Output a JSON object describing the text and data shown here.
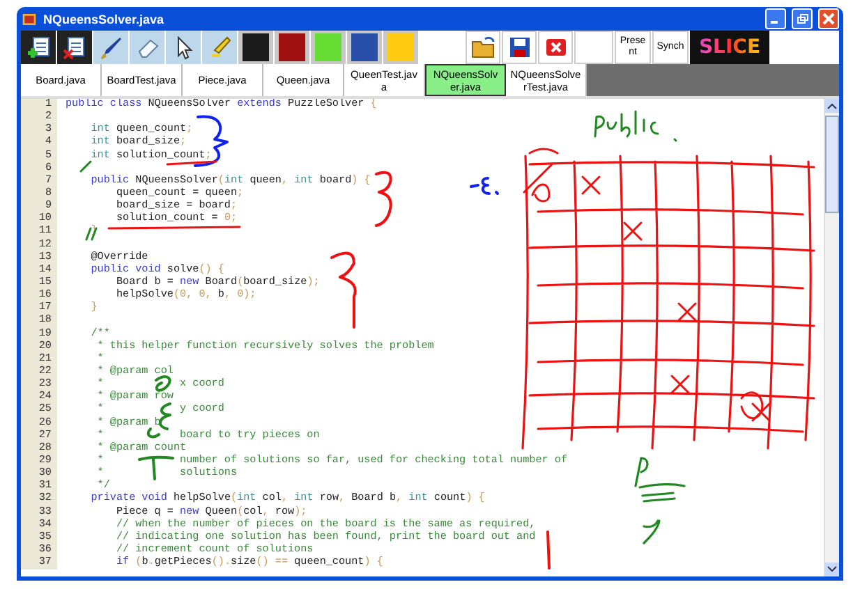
{
  "window": {
    "title": "NQueensSolver.java"
  },
  "toolbar": {
    "colors": [
      {
        "color": "#1a1a1a"
      },
      {
        "color": "#a01010"
      },
      {
        "color": "#66dd33"
      },
      {
        "color": "#2850a8"
      },
      {
        "color": "#ffcc11"
      }
    ],
    "text_buttons": [
      "Present",
      "Synch"
    ],
    "logo": "SLICE"
  },
  "tabs": [
    {
      "label": "Board.java",
      "selected": false
    },
    {
      "label": "BoardTest.java",
      "selected": false
    },
    {
      "label": "Piece.java",
      "selected": false
    },
    {
      "label": "Queen.java",
      "selected": false
    },
    {
      "label": "QueenTest.java",
      "selected": false
    },
    {
      "label": "NQueensSolver.java",
      "selected": true
    },
    {
      "label": "NQueensSolverTest.java",
      "selected": false
    }
  ],
  "editor": {
    "lines": [
      {
        "num": "1",
        "segments": [
          {
            "t": "public class ",
            "kind": "keyword"
          },
          {
            "t": "NQueensSolver ",
            "kind": "plain"
          },
          {
            "t": "extends ",
            "kind": "keyword"
          },
          {
            "t": "PuzzleSolver ",
            "kind": "plain"
          },
          {
            "t": "{",
            "kind": "punct"
          }
        ]
      },
      {
        "num": "2"
      },
      {
        "num": "3",
        "segments": [
          {
            "t": "    int ",
            "kind": "type"
          },
          {
            "t": "queen_count",
            "kind": "plain"
          },
          {
            "t": ";",
            "kind": "punct"
          }
        ]
      },
      {
        "num": "4",
        "segments": [
          {
            "t": "    int ",
            "kind": "type"
          },
          {
            "t": "board_size",
            "kind": "plain"
          },
          {
            "t": ";",
            "kind": "punct"
          }
        ]
      },
      {
        "num": "5",
        "segments": [
          {
            "t": "    int ",
            "kind": "type"
          },
          {
            "t": "solution_count",
            "kind": "plain"
          },
          {
            "t": ";",
            "kind": "punct"
          }
        ]
      },
      {
        "num": "6"
      },
      {
        "num": "7",
        "segments": [
          {
            "t": "    public ",
            "kind": "keyword"
          },
          {
            "t": "NQueensSolver",
            "kind": "plain"
          },
          {
            "t": "(",
            "kind": "punct"
          },
          {
            "t": "int ",
            "kind": "type"
          },
          {
            "t": "queen",
            "kind": "plain"
          },
          {
            "t": ", ",
            "kind": "punct"
          },
          {
            "t": "int ",
            "kind": "type"
          },
          {
            "t": "board",
            "kind": "plain"
          },
          {
            "t": ") {",
            "kind": "punct"
          }
        ]
      },
      {
        "num": "8",
        "segments": [
          {
            "t": "        queen_count = queen",
            "kind": "plain"
          },
          {
            "t": ";",
            "kind": "punct"
          }
        ]
      },
      {
        "num": "9",
        "segments": [
          {
            "t": "        board_size = board",
            "kind": "plain"
          },
          {
            "t": ";",
            "kind": "punct"
          }
        ]
      },
      {
        "num": "10",
        "segments": [
          {
            "t": "        solution_count = ",
            "kind": "plain"
          },
          {
            "t": "0;",
            "kind": "punct"
          }
        ]
      },
      {
        "num": "11",
        "segments": [
          {
            "t": "    }",
            "kind": "punct"
          }
        ]
      },
      {
        "num": "12"
      },
      {
        "num": "13",
        "segments": [
          {
            "t": "    @Override",
            "kind": "plain"
          }
        ]
      },
      {
        "num": "14",
        "segments": [
          {
            "t": "    public void ",
            "kind": "keyword"
          },
          {
            "t": "solve",
            "kind": "plain"
          },
          {
            "t": "() {",
            "kind": "punct"
          }
        ]
      },
      {
        "num": "15",
        "segments": [
          {
            "t": "        Board b = ",
            "kind": "plain"
          },
          {
            "t": "new ",
            "kind": "keyword"
          },
          {
            "t": "Board",
            "kind": "plain"
          },
          {
            "t": "(",
            "kind": "punct"
          },
          {
            "t": "board_size",
            "kind": "plain"
          },
          {
            "t": ");",
            "kind": "punct"
          }
        ]
      },
      {
        "num": "16",
        "segments": [
          {
            "t": "        helpSolve",
            "kind": "plain"
          },
          {
            "t": "(0, 0, ",
            "kind": "punct"
          },
          {
            "t": "b",
            "kind": "plain"
          },
          {
            "t": ", 0);",
            "kind": "punct"
          }
        ]
      },
      {
        "num": "17",
        "segments": [
          {
            "t": "    }",
            "kind": "punct"
          }
        ]
      },
      {
        "num": "18"
      },
      {
        "num": "19",
        "segments": [
          {
            "t": "    /**",
            "kind": "comment"
          }
        ]
      },
      {
        "num": "20",
        "segments": [
          {
            "t": "     * this helper function recursively solves the problem",
            "kind": "comment"
          }
        ]
      },
      {
        "num": "21",
        "segments": [
          {
            "t": "     *",
            "kind": "comment"
          }
        ]
      },
      {
        "num": "22",
        "segments": [
          {
            "t": "     * @param col",
            "kind": "comment"
          }
        ]
      },
      {
        "num": "23",
        "segments": [
          {
            "t": "     *            x coord",
            "kind": "comment"
          }
        ]
      },
      {
        "num": "24",
        "segments": [
          {
            "t": "     * @param row",
            "kind": "comment"
          }
        ]
      },
      {
        "num": "25",
        "segments": [
          {
            "t": "     *            y coord",
            "kind": "comment"
          }
        ]
      },
      {
        "num": "26",
        "segments": [
          {
            "t": "     * @param b",
            "kind": "comment"
          }
        ]
      },
      {
        "num": "27",
        "segments": [
          {
            "t": "     *            board to try pieces on",
            "kind": "comment"
          }
        ]
      },
      {
        "num": "28",
        "segments": [
          {
            "t": "     * @param count",
            "kind": "comment"
          }
        ]
      },
      {
        "num": "29",
        "segments": [
          {
            "t": "     *            number of solutions so far, used for checking total number of",
            "kind": "comment"
          }
        ]
      },
      {
        "num": "30",
        "segments": [
          {
            "t": "     *            solutions",
            "kind": "comment"
          }
        ]
      },
      {
        "num": "31",
        "segments": [
          {
            "t": "     */",
            "kind": "comment"
          }
        ]
      },
      {
        "num": "32",
        "segments": [
          {
            "t": "    private void ",
            "kind": "keyword"
          },
          {
            "t": "helpSolve",
            "kind": "plain"
          },
          {
            "t": "(",
            "kind": "punct"
          },
          {
            "t": "int ",
            "kind": "type"
          },
          {
            "t": "col",
            "kind": "plain"
          },
          {
            "t": ", ",
            "kind": "punct"
          },
          {
            "t": "int ",
            "kind": "type"
          },
          {
            "t": "row",
            "kind": "plain"
          },
          {
            "t": ", ",
            "kind": "punct"
          },
          {
            "t": "Board b",
            "kind": "plain"
          },
          {
            "t": ", ",
            "kind": "punct"
          },
          {
            "t": "int ",
            "kind": "type"
          },
          {
            "t": "count",
            "kind": "plain"
          },
          {
            "t": ") {",
            "kind": "punct"
          }
        ]
      },
      {
        "num": "33",
        "segments": [
          {
            "t": "        Piece q = ",
            "kind": "plain"
          },
          {
            "t": "new ",
            "kind": "keyword"
          },
          {
            "t": "Queen",
            "kind": "plain"
          },
          {
            "t": "(",
            "kind": "punct"
          },
          {
            "t": "col",
            "kind": "plain"
          },
          {
            "t": ", ",
            "kind": "punct"
          },
          {
            "t": "row",
            "kind": "plain"
          },
          {
            "t": ");",
            "kind": "punct"
          }
        ]
      },
      {
        "num": "34",
        "segments": [
          {
            "t": "        // when the number of pieces on the board is the same as required,",
            "kind": "comment"
          }
        ]
      },
      {
        "num": "35",
        "segments": [
          {
            "t": "        // indicating one solution has been found, print the board out and",
            "kind": "comment"
          }
        ]
      },
      {
        "num": "36",
        "segments": [
          {
            "t": "        // increment count of solutions",
            "kind": "comment"
          }
        ]
      },
      {
        "num": "37",
        "segments": [
          {
            "t": "        if ",
            "kind": "keyword"
          },
          {
            "t": "(",
            "kind": "punct"
          },
          {
            "t": "b",
            "kind": "plain"
          },
          {
            "t": ".",
            "kind": "punct"
          },
          {
            "t": "getPieces",
            "kind": "plain"
          },
          {
            "t": "().",
            "kind": "punct"
          },
          {
            "t": "size",
            "kind": "plain"
          },
          {
            "t": "() == ",
            "kind": "punct"
          },
          {
            "t": "queen_count",
            "kind": "plain"
          },
          {
            "t": ") {",
            "kind": "punct"
          }
        ]
      }
    ]
  }
}
